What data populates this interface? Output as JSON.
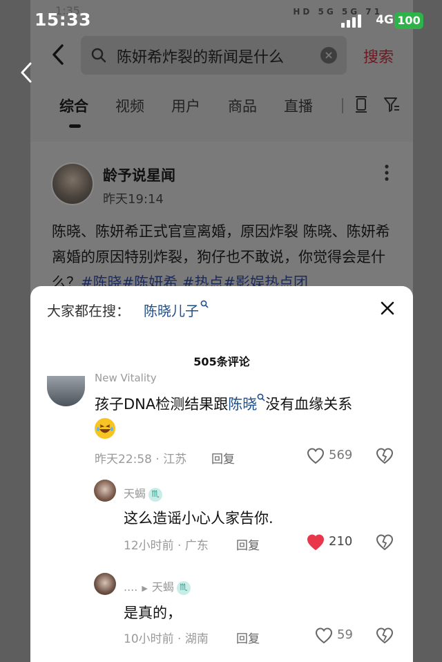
{
  "outer_status": {
    "time": "15:33",
    "network": "4G",
    "battery": "100"
  },
  "inner_status": {
    "time": "1:35",
    "icons": "HD 5G 5G 71"
  },
  "search": {
    "query": "陈妍希炸裂的新闻是什么",
    "button": "搜索"
  },
  "tabs": [
    {
      "label": "综合"
    },
    {
      "label": "视频"
    },
    {
      "label": "用户"
    },
    {
      "label": "商品"
    },
    {
      "label": "直播"
    }
  ],
  "post": {
    "author": "龄予说星闻",
    "time": "昨天19:14",
    "text_plain": "陈晓、陈妍希正式官宣离婚，原因炸裂 陈晓、陈妍希离婚的原因特别炸裂，狗仔也不敢说，你觉得会是什么？",
    "tags": "#陈晓#陈妍希 #热点#影娱热点团"
  },
  "sheet": {
    "hot_label": "大家都在搜：",
    "hot_query": "陈晓儿子",
    "comments_count": "505条评论",
    "comments": [
      {
        "name": "New Vitality",
        "text_before": "孩子DNA检测结果跟",
        "link": "陈晓",
        "text_after": "没有血缘关系",
        "meta": "昨天22:58 · 江苏",
        "reply": "回复",
        "likes": "569",
        "liked": false
      },
      {
        "name": "天蝎",
        "text": "这么造谣小心人家告你.",
        "meta": "12小时前 · 广东",
        "reply": "回复",
        "likes": "210",
        "liked": true
      },
      {
        "name_prefix": "....",
        "name": "天蝎",
        "text": "是真的，",
        "meta": "10小时前 · 湖南",
        "reply": "回复",
        "likes": "59",
        "liked": false
      }
    ]
  },
  "colors": {
    "like_active": "#e8364a",
    "link": "#1f4f8a",
    "battery_green": "#2fb24a",
    "search_button": "#6e1821"
  }
}
